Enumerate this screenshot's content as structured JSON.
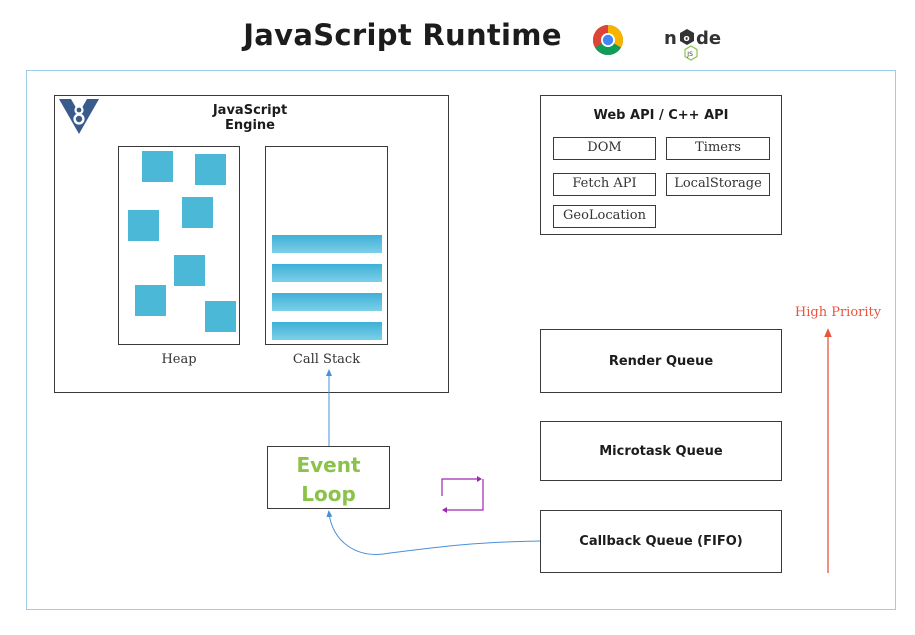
{
  "title": "JavaScript Runtime",
  "engine": {
    "title": "JavaScript Engine",
    "heap_label": "Heap",
    "callstack_label": "Call Stack"
  },
  "web_api": {
    "title": "Web API / C++ API",
    "items": [
      "DOM",
      "Timers",
      "Fetch API",
      "LocalStorage",
      "GeoLocation"
    ]
  },
  "event_loop": {
    "line1": "Event",
    "line2": "Loop"
  },
  "queues": {
    "render": "Render Queue",
    "microtask": "Microtask Queue",
    "callback": "Callback Queue (FIFO)"
  },
  "priority_label": "High Priority",
  "icons": [
    "chrome-icon",
    "nodejs-icon",
    "v8-icon"
  ],
  "colors": {
    "accent_blue": "#4cb8d8",
    "event_loop_green": "#8bc34a",
    "priority_red": "#e8553e",
    "loop_purple": "#9c27b0",
    "border_blue": "#9ccfe6"
  }
}
